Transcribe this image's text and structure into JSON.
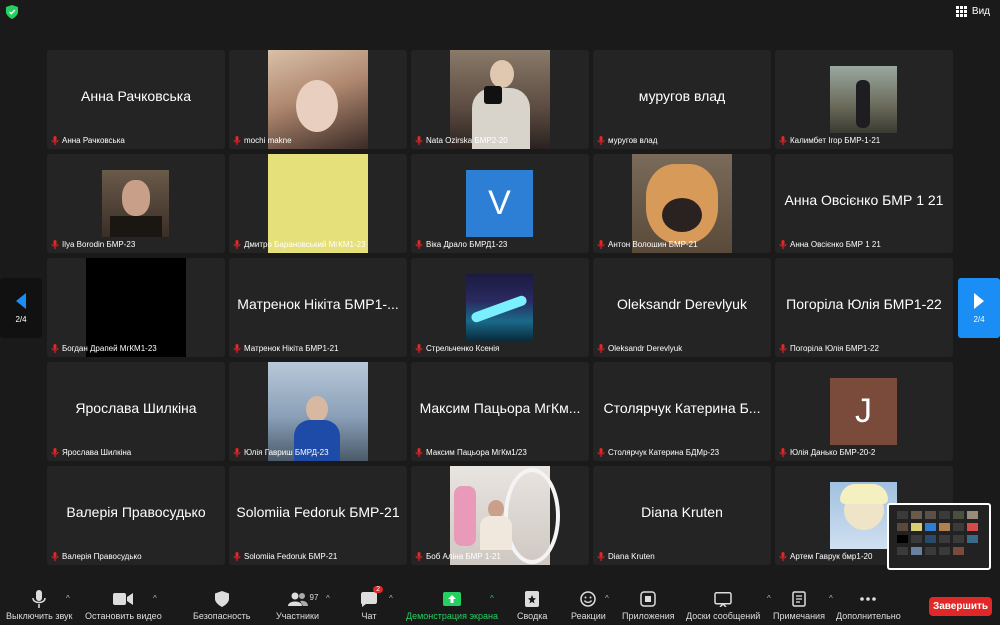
{
  "topbar": {
    "view_label": "Вид"
  },
  "pager": {
    "left_label": "2/4",
    "right_label": "2/4"
  },
  "tiles": [
    {
      "big": "Анна Рачковська",
      "label": "Анна Рачковська"
    },
    {
      "big": "",
      "label": "mochi makne"
    },
    {
      "big": "",
      "label": "Nata Ozirska БМР2-20"
    },
    {
      "big": "муругов влад",
      "label": "муругов влад"
    },
    {
      "big": "",
      "label": "Калимбет Ігор БМР-1-21"
    },
    {
      "big": "",
      "label": "Ilya Borodin БМР-23"
    },
    {
      "big": "",
      "label": "Дмитро Барановський МгКМ1-23"
    },
    {
      "big": "V",
      "label": "Віка Драло БМРД1-23"
    },
    {
      "big": "",
      "label": "Антон Волошин БМР-21"
    },
    {
      "big": "Анна Овсієнко БМР 1 21",
      "label": "Анна Овсієнко БМР 1 21"
    },
    {
      "big": "",
      "label": "Богдан Драпей МгКМ1-23"
    },
    {
      "big": "Матренок Нікіта БМР1-...",
      "label": "Матренок Нікіта БМР1-21"
    },
    {
      "big": "",
      "label": "Стрельченко Ксенія"
    },
    {
      "big": "Oleksandr Derevlyuk",
      "label": "Oleksandr Derevlyuk"
    },
    {
      "big": "Погоріла Юлія БМР1-22",
      "label": "Погоріла Юлія БМР1-22"
    },
    {
      "big": "Ярослава Шилкіна",
      "label": "Ярослава Шилкіна"
    },
    {
      "big": "",
      "label": "Юлія Гавриш БМРД-23"
    },
    {
      "big": "Максим Пацьора МгКм...",
      "label": "Максим Пацьора МгКм1/23"
    },
    {
      "big": "Столярчук Катерина Б...",
      "label": "Столярчук Катерина БДМр-23"
    },
    {
      "big": "J",
      "label": "Юлія Данько БМР-20-2"
    },
    {
      "big": "Валерія Правосудько",
      "label": "Валерія Правосудько"
    },
    {
      "big": "Solomiia Fedoruk БМР-21",
      "label": "Solomiia Fedoruk БМР-21"
    },
    {
      "big": "",
      "label": "Боб Аліна БМР 1-21"
    },
    {
      "big": "Diana Kruten",
      "label": "Diana Kruten"
    },
    {
      "big": "",
      "label": "Артем Гаврук бмр1-20"
    }
  ],
  "toolbar": {
    "mute": "Выключить звук",
    "video": "Остановить видео",
    "security": "Безопасность",
    "participants": "Участники",
    "participants_count": "97",
    "chat": "Чат",
    "chat_badge": "2",
    "share": "Демонстрация экрана",
    "whiteboard": "Сводка",
    "reactions": "Реакции",
    "apps": "Приложения",
    "boards": "Доски сообщений",
    "notes": "Примечания",
    "more": "Дополнительно",
    "end": "Завершить"
  },
  "colors": {
    "accent": "#1a8ef4",
    "share": "#23d160",
    "danger": "#e02828"
  }
}
